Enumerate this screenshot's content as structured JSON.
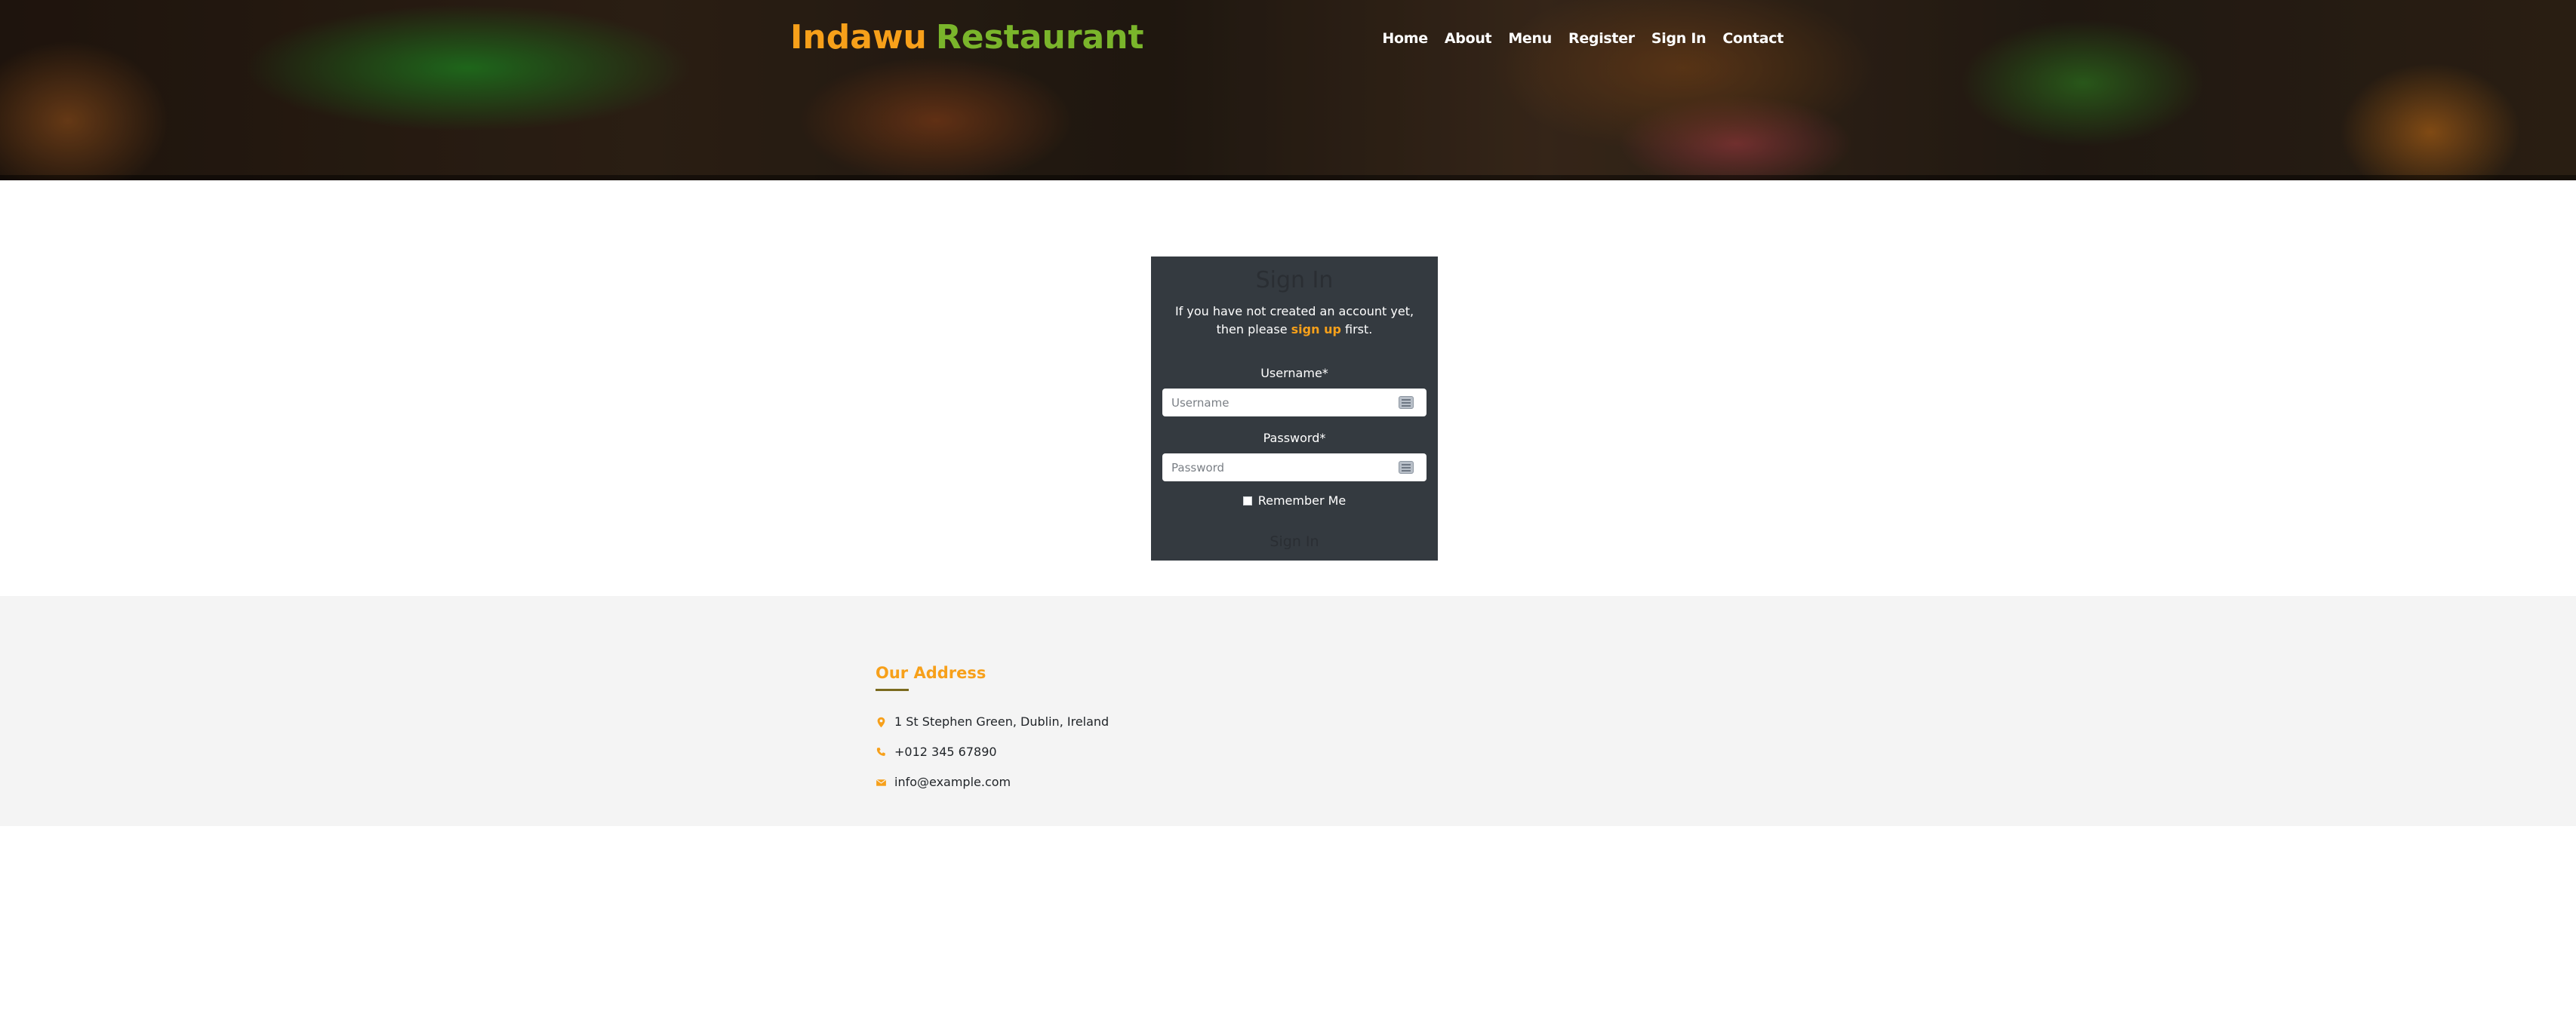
{
  "header": {
    "brand_part1": "Indawu",
    "brand_part2": "Restaurant",
    "nav": [
      {
        "label": "Home"
      },
      {
        "label": "About"
      },
      {
        "label": "Menu"
      },
      {
        "label": "Register"
      },
      {
        "label": "Sign In"
      },
      {
        "label": "Contact"
      }
    ]
  },
  "signin": {
    "title": "Sign In",
    "intro_before": "If you have not created an account yet, then please",
    "intro_link": "sign up",
    "intro_after": "first.",
    "username_label": "Username*",
    "username_placeholder": "Username",
    "password_label": "Password*",
    "password_placeholder": "Password",
    "remember_label": "Remember Me",
    "submit_label": "Sign In"
  },
  "footer": {
    "heading": "Our Address",
    "address": "1 St Stephen Green, Dublin, Ireland",
    "phone": "+012 345 67890",
    "email": "info@example.com"
  },
  "colors": {
    "accent_orange": "#f7a01a",
    "accent_green": "#7ab52b",
    "card_background": "#343a40",
    "footer_background": "#f4f4f4"
  },
  "icons": {
    "address": "map-marker-icon",
    "phone": "phone-icon",
    "email": "envelope-icon",
    "field_autofill": "autofill-key-icon"
  }
}
